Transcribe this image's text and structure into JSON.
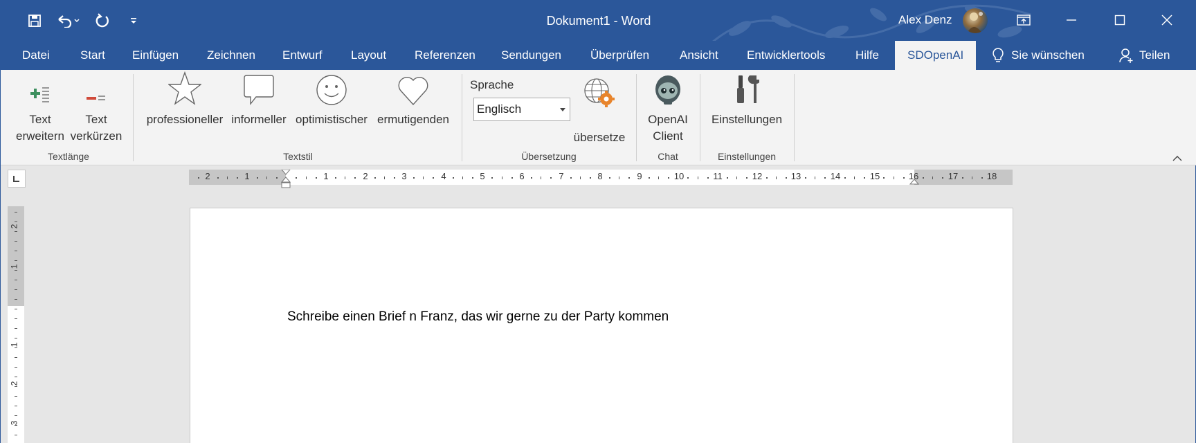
{
  "window": {
    "title": "Dokument1  -  Word",
    "user_name": "Alex Denz",
    "accent_color": "#2b579a"
  },
  "quick_access": [
    {
      "icon": "save-icon"
    },
    {
      "icon": "undo-icon"
    },
    {
      "icon": "redo-icon"
    },
    {
      "icon": "customize-qat-icon"
    }
  ],
  "tabs": [
    {
      "label": "Datei"
    },
    {
      "label": "Start"
    },
    {
      "label": "Einfügen"
    },
    {
      "label": "Zeichnen"
    },
    {
      "label": "Entwurf"
    },
    {
      "label": "Layout"
    },
    {
      "label": "Referenzen"
    },
    {
      "label": "Sendungen"
    },
    {
      "label": "Überprüfen"
    },
    {
      "label": "Ansicht"
    },
    {
      "label": "Entwicklertools"
    },
    {
      "label": "Hilfe"
    },
    {
      "label": "SDOpenAI",
      "active": true
    }
  ],
  "tell_me": "Sie wünschen",
  "share": "Teilen",
  "ribbon": {
    "textlaenge": {
      "group_label": "Textlänge",
      "expand_label_1": "Text",
      "expand_label_2": "erweitern",
      "shorten_label_1": "Text",
      "shorten_label_2": "verkürzen"
    },
    "textstil": {
      "group_label": "Textstil",
      "professional": "professioneller",
      "informal": "informeller",
      "optimistic": "optimistischer",
      "encouraging": "ermutigenden"
    },
    "uebersetzung": {
      "group_label": "Übersetzung",
      "language_label": "Sprache",
      "language_value": "Englisch",
      "translate_label": "übersetze"
    },
    "chat": {
      "group_label": "Chat",
      "client_label_1": "OpenAI",
      "client_label_2": "Client"
    },
    "einstellungen": {
      "group_label": "Einstellungen",
      "settings_label": "Einstellungen"
    }
  },
  "ruler": {
    "left_numbers": [
      "2",
      "1"
    ],
    "right_numbers": [
      "1",
      "2",
      "3",
      "4",
      "5",
      "6",
      "7",
      "8",
      "9",
      "10",
      "11",
      "12",
      "13",
      "14",
      "15",
      "16",
      "17",
      "18"
    ],
    "vertical_numbers": [
      "2",
      "1",
      "1",
      "2",
      "3"
    ]
  },
  "document": {
    "text": "Schreibe einen Brief n Franz, das wir gerne zu der Party kommen"
  }
}
